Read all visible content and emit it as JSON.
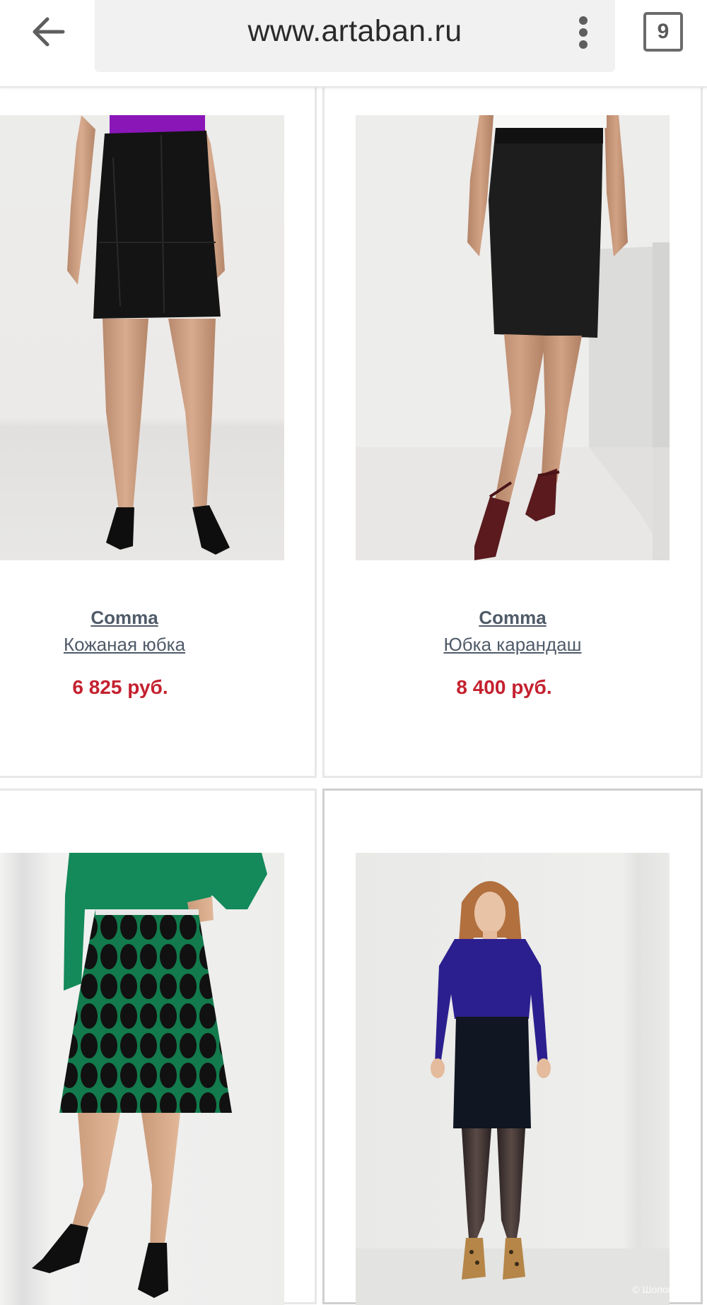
{
  "browser": {
    "url": "www.artaban.ru",
    "tab_count": "9",
    "back_icon": "arrow-left-icon",
    "menu_icon": "more-vert-icon"
  },
  "colors": {
    "price": "#c4212f",
    "link": "#505b69",
    "card_border": "#e7e7e7"
  },
  "products": [
    {
      "brand": "Comma",
      "name": "Кожаная юбка",
      "price": "6 825 руб."
    },
    {
      "brand": "Comma",
      "name": "Юбка карандаш",
      "price": "8 400 руб."
    },
    {
      "brand": "",
      "name": "",
      "price": ""
    },
    {
      "brand": "",
      "name": "",
      "price": ""
    }
  ],
  "watermark": "© Шопоголик"
}
